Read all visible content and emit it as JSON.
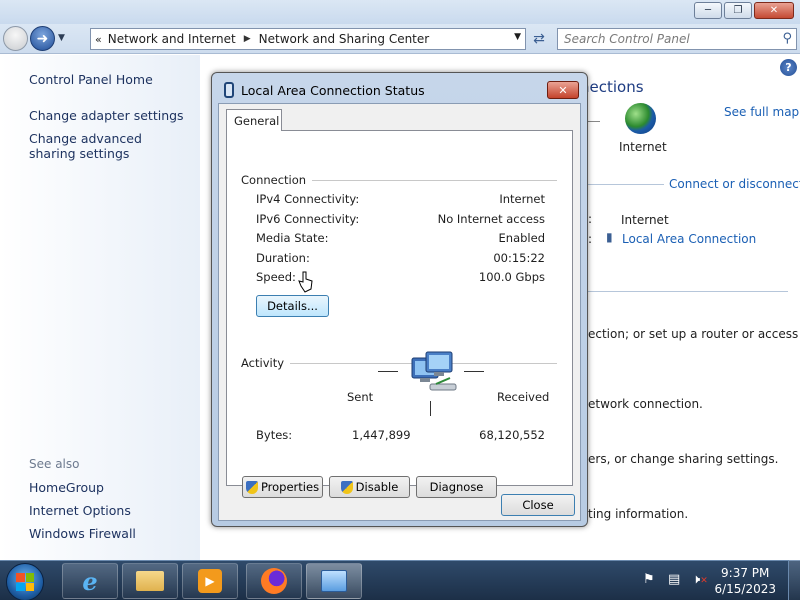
{
  "window": {
    "controls": {
      "minimize_icon": "minimize-icon",
      "maximize_icon": "maximize-icon",
      "close_icon": "close-icon"
    }
  },
  "navigation": {
    "breadcrumb": [
      "Network and Internet",
      "Network and Sharing Center"
    ],
    "search_placeholder": "Search Control Panel"
  },
  "sidebar": {
    "items": [
      "Control Panel Home",
      "Change adapter settings",
      "Change advanced sharing settings"
    ],
    "see_also_label": "See also",
    "see_also": [
      "HomeGroup",
      "Internet Options",
      "Windows Firewall"
    ]
  },
  "background": {
    "heading_fragment": "nections",
    "see_full_map": "See full map",
    "internet_label": "Internet",
    "connect_disconnect": "Connect or disconnect",
    "access_type_value": "Internet",
    "connections_value": "Local Area Connection",
    "colon": ":",
    "line1": "ection; or set up a router or access",
    "line2": "etwork connection.",
    "line3": "ers, or change sharing settings.",
    "line4": "ting information."
  },
  "dialog": {
    "title": "Local Area Connection Status",
    "tab_general": "General",
    "connection_group": "Connection",
    "connection_rows": [
      {
        "label": "IPv4 Connectivity:",
        "value": "Internet"
      },
      {
        "label": "IPv6 Connectivity:",
        "value": "No Internet access"
      },
      {
        "label": "Media State:",
        "value": "Enabled"
      },
      {
        "label": "Duration:",
        "value": "00:15:22"
      },
      {
        "label": "Speed:",
        "value": "100.0 Gbps"
      }
    ],
    "details_button": "Details...",
    "activity_group": "Activity",
    "sent_label": "Sent",
    "received_label": "Received",
    "bytes_label": "Bytes:",
    "bytes_sent": "1,447,899",
    "bytes_received": "68,120,552",
    "properties_button": "Properties",
    "disable_button": "Disable",
    "diagnose_button": "Diagnose",
    "close_button": "Close"
  },
  "taskbar": {
    "time": "9:37 PM",
    "date": "6/15/2023"
  },
  "colors": {
    "link": "#1a5fb4",
    "sidebar_link": "#1e3360",
    "dialog_frame": "#b7cbe3",
    "taskbar": "#1c2f47"
  }
}
